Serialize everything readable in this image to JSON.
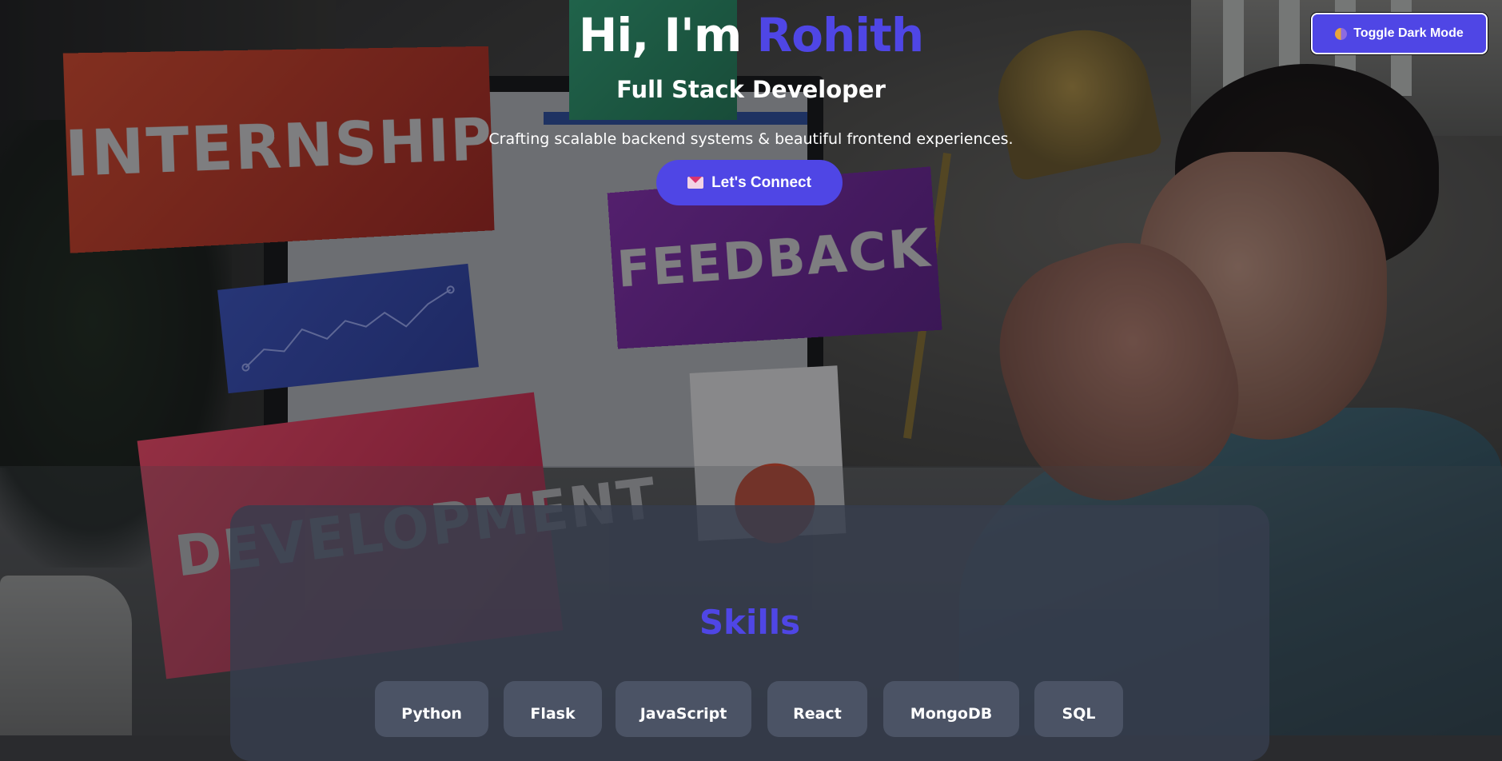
{
  "header": {
    "toggle_label": "Toggle Dark Mode",
    "toggle_icon": "half-circle-icon"
  },
  "hero": {
    "greeting": "Hi, I'm",
    "name": "Rohith",
    "role": "Full Stack Developer",
    "tagline": "Crafting scalable backend systems & beautiful frontend experiences.",
    "cta_label": "Let's Connect",
    "cta_icon": "envelope-icon"
  },
  "background": {
    "sign_internship": "INTERNSHIP",
    "sign_feedback": "FEEDBACK",
    "sign_development": "DEVELOPMENT"
  },
  "skills": {
    "title": "Skills",
    "items": [
      "Python",
      "Flask",
      "JavaScript",
      "React",
      "MongoDB",
      "SQL"
    ]
  },
  "colors": {
    "accent": "#4f46e5",
    "card": "#373e4e",
    "chip": "#4b5365"
  }
}
